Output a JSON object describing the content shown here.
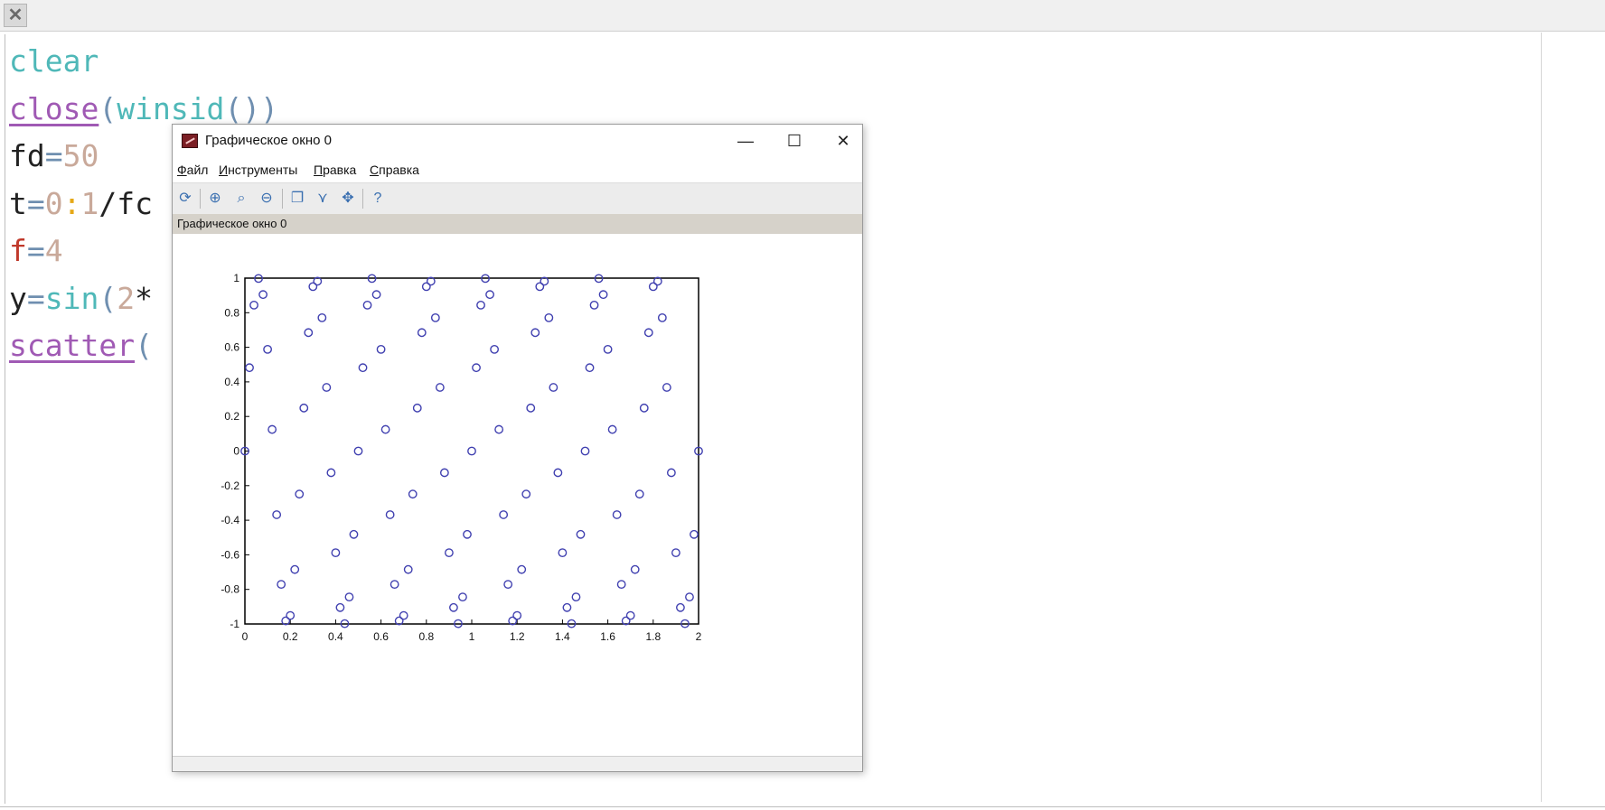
{
  "editor": {
    "lines": [
      [
        {
          "t": "clear",
          "c": "kw-teal"
        }
      ],
      [
        {
          "t": "close",
          "c": "kw-purple"
        },
        {
          "t": "(",
          "c": "paren"
        },
        {
          "t": "winsid",
          "c": "kw-teal"
        },
        {
          "t": "())",
          "c": "paren"
        }
      ],
      [
        {
          "t": "fd",
          "c": "var"
        },
        {
          "t": "=",
          "c": "op"
        },
        {
          "t": "50",
          "c": "num"
        }
      ],
      [
        {
          "t": "t",
          "c": "var"
        },
        {
          "t": "=",
          "c": "op"
        },
        {
          "t": "0",
          "c": "num"
        },
        {
          "t": ":",
          "c": "colon"
        },
        {
          "t": "1",
          "c": "num"
        },
        {
          "t": "/fc",
          "c": "var"
        }
      ],
      [
        {
          "t": "f",
          "c": "num-red"
        },
        {
          "t": "=",
          "c": "op"
        },
        {
          "t": "4",
          "c": "num"
        }
      ],
      [
        {
          "t": "y",
          "c": "var"
        },
        {
          "t": "=",
          "c": "op"
        },
        {
          "t": "sin",
          "c": "kw-teal"
        },
        {
          "t": "(",
          "c": "paren"
        },
        {
          "t": "2",
          "c": "num"
        },
        {
          "t": "*",
          "c": "var"
        }
      ],
      [
        {
          "t": "scatter",
          "c": "kw-purple"
        },
        {
          "t": "(",
          "c": "paren"
        }
      ]
    ]
  },
  "graphic_window": {
    "title": "Графическое окно 0",
    "subtitle": "Графическое окно 0",
    "menu": [
      "Файл",
      "Инструменты",
      "Правка",
      "Справка"
    ],
    "controls": {
      "minimize": "—",
      "maximize": "☐",
      "close": "✕"
    },
    "toolbar_icons": [
      "rotate-icon",
      "zoom-in-icon",
      "zoom-fit-icon",
      "zoom-out-icon",
      "copy-window-icon",
      "datatip-icon",
      "pan-icon",
      "help-icon"
    ]
  },
  "chart_data": {
    "type": "scatter",
    "title": "",
    "xlabel": "",
    "ylabel": "",
    "xlim": [
      0,
      2
    ],
    "ylim": [
      -1,
      1
    ],
    "xticks": [
      "0",
      "0.2",
      "0.4",
      "0.6",
      "0.8",
      "1",
      "1.2",
      "1.4",
      "1.6",
      "1.8",
      "2"
    ],
    "yticks": [
      "-1",
      "-0.8",
      "-0.6",
      "-0.4",
      "-0.2",
      "0",
      "0.2",
      "0.4",
      "0.6",
      "0.8",
      "1"
    ],
    "marker": "circle",
    "marker_color": "#4040b0",
    "fs": 50,
    "frequency": 4,
    "x": [
      0,
      0.02,
      0.04,
      0.06,
      0.08,
      0.1,
      0.12,
      0.14,
      0.16,
      0.18,
      0.2,
      0.22,
      0.24,
      0.26,
      0.28,
      0.3,
      0.32,
      0.34,
      0.36,
      0.38,
      0.4,
      0.42,
      0.44,
      0.46,
      0.48,
      0.5,
      0.52,
      0.54,
      0.56,
      0.58,
      0.6,
      0.62,
      0.64,
      0.66,
      0.68,
      0.7,
      0.72,
      0.74,
      0.76,
      0.78,
      0.8,
      0.82,
      0.84,
      0.86,
      0.88,
      0.9,
      0.92,
      0.94,
      0.96,
      0.98,
      1,
      1.02,
      1.04,
      1.06,
      1.08,
      1.1,
      1.12,
      1.14,
      1.16,
      1.18,
      1.2,
      1.22,
      1.24,
      1.26,
      1.28,
      1.3,
      1.32,
      1.34,
      1.36,
      1.38,
      1.4,
      1.42,
      1.44,
      1.46,
      1.48,
      1.5,
      1.52,
      1.54,
      1.56,
      1.58,
      1.6,
      1.62,
      1.64,
      1.66,
      1.68,
      1.7,
      1.72,
      1.74,
      1.76,
      1.78,
      1.8,
      1.82,
      1.84,
      1.86,
      1.88,
      1.9,
      1.92,
      1.94,
      1.96,
      1.98,
      2
    ],
    "y": [
      0,
      0.482,
      0.844,
      0.998,
      0.905,
      0.588,
      0.125,
      -0.368,
      -0.771,
      -0.982,
      -0.951,
      -0.685,
      -0.249,
      0.249,
      0.685,
      0.951,
      0.982,
      0.771,
      0.368,
      -0.125,
      -0.588,
      -0.905,
      -0.998,
      -0.844,
      -0.482,
      0,
      0.482,
      0.844,
      0.998,
      0.905,
      0.588,
      0.125,
      -0.368,
      -0.771,
      -0.982,
      -0.951,
      -0.685,
      -0.249,
      0.249,
      0.685,
      0.951,
      0.982,
      0.771,
      0.368,
      -0.125,
      -0.588,
      -0.905,
      -0.998,
      -0.844,
      -0.482,
      0,
      0.482,
      0.844,
      0.998,
      0.905,
      0.588,
      0.125,
      -0.368,
      -0.771,
      -0.982,
      -0.951,
      -0.685,
      -0.249,
      0.249,
      0.685,
      0.951,
      0.982,
      0.771,
      0.368,
      -0.125,
      -0.588,
      -0.905,
      -0.998,
      -0.844,
      -0.482,
      0,
      0.482,
      0.844,
      0.998,
      0.905,
      0.588,
      0.125,
      -0.368,
      -0.771,
      -0.982,
      -0.951,
      -0.685,
      -0.249,
      0.249,
      0.685,
      0.951,
      0.982,
      0.771,
      0.368,
      -0.125,
      -0.588,
      -0.905,
      -0.998,
      -0.844,
      -0.482,
      0
    ]
  }
}
